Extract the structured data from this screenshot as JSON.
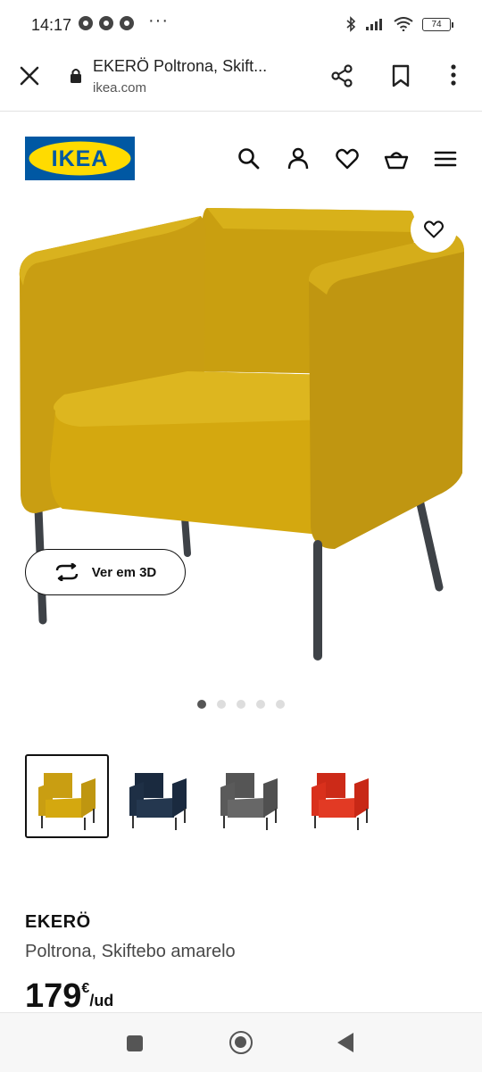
{
  "status_bar": {
    "time": "14:17",
    "more": "···",
    "battery": "74"
  },
  "browser": {
    "page_title": "EKERÖ Poltrona, Skift...",
    "host": "ikea.com",
    "icons": [
      "close-icon",
      "lock-icon",
      "share-icon",
      "bookmark-icon",
      "more-vert-icon"
    ]
  },
  "header": {
    "logo_text": "IKEA",
    "icons": [
      "search-icon",
      "account-icon",
      "heart-icon",
      "basket-icon",
      "menu-icon"
    ]
  },
  "gallery": {
    "view_3d_label": "Ver em 3D",
    "pages": 5,
    "active_page": 1
  },
  "swatches": [
    {
      "color": "#d4a80f",
      "selected": true
    },
    {
      "color": "#1e2f45",
      "selected": false
    },
    {
      "color": "#5a5a5a",
      "selected": false
    },
    {
      "color": "#d9301c",
      "selected": false
    }
  ],
  "product": {
    "name": "EKERÖ",
    "description": "Poltrona, Skiftebo amarelo",
    "price": "179",
    "currency": "€",
    "unit": "/ud"
  },
  "colors": {
    "ikea_blue": "#0058a3",
    "ikea_yellow": "#ffdb00",
    "chair_yellow": "#d4a80f"
  }
}
